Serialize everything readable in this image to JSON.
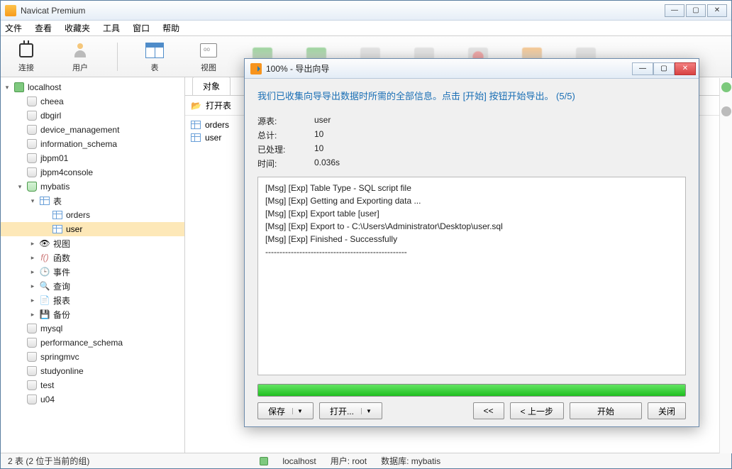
{
  "app": {
    "title": "Navicat Premium"
  },
  "winbtns": {
    "min": "—",
    "max": "▢",
    "close": "✕"
  },
  "menu": [
    "文件",
    "查看",
    "收藏夹",
    "工具",
    "窗口",
    "帮助"
  ],
  "toolbar": {
    "connect": "连接",
    "user": "用户",
    "table": "表",
    "view": "视图"
  },
  "sidebar": {
    "root": "localhost",
    "dbs_above": [
      "cheea",
      "dbgirl",
      "device_management",
      "information_schema",
      "jbpm01",
      "jbpm4console"
    ],
    "current_db": "mybatis",
    "table_group": "表",
    "tables": [
      "orders",
      "user"
    ],
    "selected_table": "user",
    "below_groups": [
      {
        "icon": "view",
        "label": "视图"
      },
      {
        "icon": "fn",
        "label": "函数"
      },
      {
        "icon": "event",
        "label": "事件"
      },
      {
        "icon": "query",
        "label": "查询"
      },
      {
        "icon": "report",
        "label": "报表"
      },
      {
        "icon": "backup",
        "label": "备份"
      }
    ],
    "dbs_below": [
      "mysql",
      "performance_schema",
      "springmvc",
      "studyonline",
      "test",
      "u04"
    ]
  },
  "main": {
    "tab": "对象",
    "open_table": "打开表",
    "list": [
      "orders",
      "user"
    ]
  },
  "dialog": {
    "title": "100% - 导出向导",
    "headline": "我们已收集向导导出数据时所需的全部信息。点击 [开始] 按钮开始导出。 (5/5)",
    "info": {
      "source_lbl": "源表:",
      "source_val": "user",
      "total_lbl": "总计:",
      "total_val": "10",
      "done_lbl": "已处理:",
      "done_val": "10",
      "time_lbl": "时间:",
      "time_val": "0.036s"
    },
    "log": [
      "[Msg] [Exp] Table Type - SQL script file",
      "[Msg] [Exp] Getting and Exporting data ...",
      "[Msg] [Exp] Export table [user]",
      "[Msg] [Exp] Export to - C:\\Users\\Administrator\\Desktop\\user.sql",
      "[Msg] [Exp] Finished - Successfully",
      "--------------------------------------------------"
    ],
    "buttons": {
      "save": "保存",
      "open": "打开...",
      "back2": "<<",
      "back": "< 上一步",
      "start": "开始",
      "close": "关闭"
    }
  },
  "status": {
    "left": "2 表 (2 位于当前的组)",
    "conn": "localhost",
    "user": "用户: root",
    "db": "数据库: mybatis"
  }
}
